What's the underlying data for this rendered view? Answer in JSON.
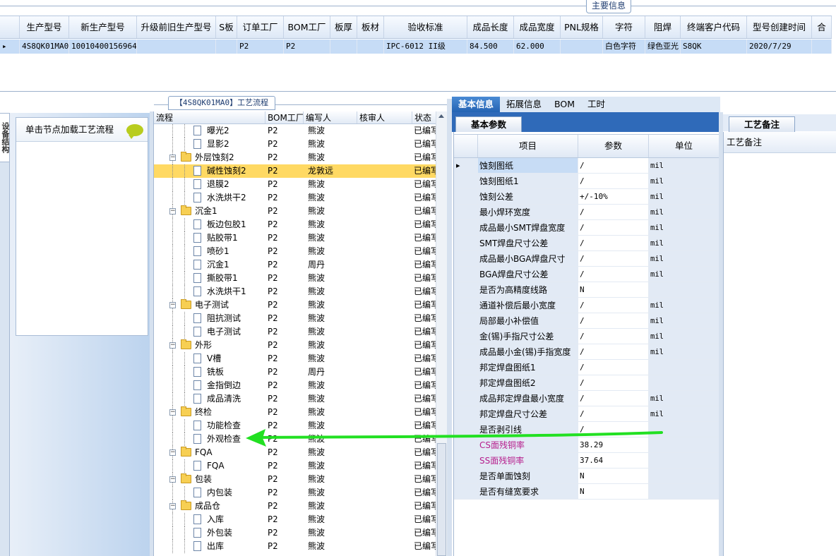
{
  "top": {
    "tab_label": "主要信息",
    "columns": [
      "",
      "生产型号",
      "新生产型号",
      "升级前旧生产型号",
      "S板",
      "订单工厂",
      "BOM工厂",
      "板厚",
      "板材",
      "验收标准",
      "成品长度",
      "成品宽度",
      "PNL规格",
      "字符",
      "阻焊",
      "终端客户代码",
      "型号创建时间",
      "合"
    ],
    "row": [
      "▸",
      "4S8QK01MA0",
      "10010400156964",
      "",
      "",
      "P2",
      "P2",
      "",
      "",
      "IPC-6012 II级",
      "84.500",
      "62.000",
      "",
      "白色字符",
      "绿色亚光",
      "S8QK",
      "2020/7/29",
      ""
    ]
  },
  "left": {
    "strip_label": "设备结构",
    "hint": "单击节点加载工艺流程"
  },
  "process": {
    "title": "【4S8QK01MA0】工艺流程",
    "columns": [
      "流程",
      "BOM工厂",
      "编写人",
      "核审人",
      "状态"
    ],
    "rows": [
      {
        "name": "曝光2",
        "level": 2,
        "bom": "P2",
        "writer": "熊波",
        "reviewer": "",
        "status": "已编写"
      },
      {
        "name": "显影2",
        "level": 2,
        "bom": "P2",
        "writer": "熊波",
        "reviewer": "",
        "status": "已编写"
      },
      {
        "name": "外层蚀刻2",
        "level": 1,
        "bom": "P2",
        "writer": "熊波",
        "reviewer": "",
        "status": "已编写"
      },
      {
        "name": "碱性蚀刻2",
        "level": 2,
        "bom": "P2",
        "writer": "龙敦远",
        "reviewer": "",
        "status": "已编写",
        "selected": true
      },
      {
        "name": "退膜2",
        "level": 2,
        "bom": "P2",
        "writer": "熊波",
        "reviewer": "",
        "status": "已编写"
      },
      {
        "name": "水洗烘干2",
        "level": 2,
        "bom": "P2",
        "writer": "熊波",
        "reviewer": "",
        "status": "已编写"
      },
      {
        "name": "沉金1",
        "level": 1,
        "bom": "P2",
        "writer": "熊波",
        "reviewer": "",
        "status": "已编写"
      },
      {
        "name": "板边包胶1",
        "level": 2,
        "bom": "P2",
        "writer": "熊波",
        "reviewer": "",
        "status": "已编写"
      },
      {
        "name": "贴胶带1",
        "level": 2,
        "bom": "P2",
        "writer": "熊波",
        "reviewer": "",
        "status": "已编写"
      },
      {
        "name": "喷砂1",
        "level": 2,
        "bom": "P2",
        "writer": "熊波",
        "reviewer": "",
        "status": "已编写"
      },
      {
        "name": "沉金1",
        "level": 2,
        "bom": "P2",
        "writer": "周丹",
        "reviewer": "",
        "status": "已编写"
      },
      {
        "name": "撕胶带1",
        "level": 2,
        "bom": "P2",
        "writer": "熊波",
        "reviewer": "",
        "status": "已编写"
      },
      {
        "name": "水洗烘干1",
        "level": 2,
        "bom": "P2",
        "writer": "熊波",
        "reviewer": "",
        "status": "已编写"
      },
      {
        "name": "电子测试",
        "level": 1,
        "bom": "P2",
        "writer": "熊波",
        "reviewer": "",
        "status": "已编写"
      },
      {
        "name": "阻抗测试",
        "level": 2,
        "bom": "P2",
        "writer": "熊波",
        "reviewer": "",
        "status": "已编写"
      },
      {
        "name": "电子测试",
        "level": 2,
        "bom": "P2",
        "writer": "熊波",
        "reviewer": "",
        "status": "已编写"
      },
      {
        "name": "外形",
        "level": 1,
        "bom": "P2",
        "writer": "熊波",
        "reviewer": "",
        "status": "已编写"
      },
      {
        "name": "V槽",
        "level": 2,
        "bom": "P2",
        "writer": "熊波",
        "reviewer": "",
        "status": "已编写"
      },
      {
        "name": "铣板",
        "level": 2,
        "bom": "P2",
        "writer": "周丹",
        "reviewer": "",
        "status": "已编写"
      },
      {
        "name": "金指倒边",
        "level": 2,
        "bom": "P2",
        "writer": "熊波",
        "reviewer": "",
        "status": "已编写"
      },
      {
        "name": "成品清洗",
        "level": 2,
        "bom": "P2",
        "writer": "熊波",
        "reviewer": "",
        "status": "已编写"
      },
      {
        "name": "终检",
        "level": 1,
        "bom": "P2",
        "writer": "熊波",
        "reviewer": "",
        "status": "已编写"
      },
      {
        "name": "功能检查",
        "level": 2,
        "bom": "P2",
        "writer": "熊波",
        "reviewer": "",
        "status": "已编写"
      },
      {
        "name": "外观检查",
        "level": 2,
        "bom": "P2",
        "writer": "熊波",
        "reviewer": "",
        "status": "已编写"
      },
      {
        "name": "FQA",
        "level": 1,
        "bom": "P2",
        "writer": "熊波",
        "reviewer": "",
        "status": "已编写"
      },
      {
        "name": "FQA",
        "level": 2,
        "bom": "P2",
        "writer": "熊波",
        "reviewer": "",
        "status": "已编写"
      },
      {
        "name": "包装",
        "level": 1,
        "bom": "P2",
        "writer": "熊波",
        "reviewer": "",
        "status": "已编写"
      },
      {
        "name": "内包装",
        "level": 2,
        "bom": "P2",
        "writer": "熊波",
        "reviewer": "",
        "status": "已编写"
      },
      {
        "name": "成品仓",
        "level": 1,
        "bom": "P2",
        "writer": "熊波",
        "reviewer": "",
        "status": "已编写"
      },
      {
        "name": "入库",
        "level": 2,
        "bom": "P2",
        "writer": "熊波",
        "reviewer": "",
        "status": "已编写"
      },
      {
        "name": "外包装",
        "level": 2,
        "bom": "P2",
        "writer": "熊波",
        "reviewer": "",
        "status": "已编写"
      },
      {
        "name": "出库",
        "level": 2,
        "bom": "P2",
        "writer": "熊波",
        "reviewer": "",
        "status": "已编写"
      }
    ]
  },
  "right": {
    "tabs": [
      "基本信息",
      "拓展信息",
      "BOM",
      "工时"
    ],
    "sub_tab": "基本参数",
    "columns": [
      "项目",
      "参数",
      "单位"
    ],
    "rows": [
      {
        "item": "蚀刻图纸",
        "value": "/",
        "unit": "mil"
      },
      {
        "item": "蚀刻图纸1",
        "value": "/",
        "unit": "mil"
      },
      {
        "item": "蚀刻公差",
        "value": "+/-10%",
        "unit": "mil"
      },
      {
        "item": "最小焊环宽度",
        "value": "/",
        "unit": "mil"
      },
      {
        "item": "成品最小SMT焊盘宽度",
        "value": "/",
        "unit": "mil"
      },
      {
        "item": "SMT焊盘尺寸公差",
        "value": "/",
        "unit": "mil"
      },
      {
        "item": "成品最小BGA焊盘尺寸",
        "value": "/",
        "unit": "mil"
      },
      {
        "item": "BGA焊盘尺寸公差",
        "value": "/",
        "unit": "mil"
      },
      {
        "item": "是否为高精度线路",
        "value": "N",
        "unit": ""
      },
      {
        "item": "通道补偿后最小宽度",
        "value": "/",
        "unit": "mil"
      },
      {
        "item": "局部最小补偿值",
        "value": "/",
        "unit": "mil"
      },
      {
        "item": "金(锡)手指尺寸公差",
        "value": "/",
        "unit": "mil"
      },
      {
        "item": "成品最小金(锡)手指宽度",
        "value": "/",
        "unit": "mil"
      },
      {
        "item": "邦定焊盘图纸1",
        "value": "/",
        "unit": ""
      },
      {
        "item": "邦定焊盘图纸2",
        "value": "/",
        "unit": ""
      },
      {
        "item": "成品邦定焊盘最小宽度",
        "value": "/",
        "unit": "mil"
      },
      {
        "item": "邦定焊盘尺寸公差",
        "value": "/",
        "unit": "mil"
      },
      {
        "item": "是否剥引线",
        "value": "/",
        "unit": ""
      },
      {
        "item": "CS面残铜率",
        "value": "38.29",
        "unit": "",
        "pink": true
      },
      {
        "item": "SS面残铜率",
        "value": "37.64",
        "unit": "",
        "pink": true
      },
      {
        "item": "是否单面蚀刻",
        "value": "N",
        "unit": ""
      },
      {
        "item": "是否有缝宽要求",
        "value": "N",
        "unit": ""
      }
    ]
  },
  "notes": {
    "tab": "工艺备注",
    "header": "工艺备注"
  },
  "colors": {
    "accent": "#2f6ab9",
    "selected_row": "#ffd963",
    "arrow": "#22e022"
  }
}
